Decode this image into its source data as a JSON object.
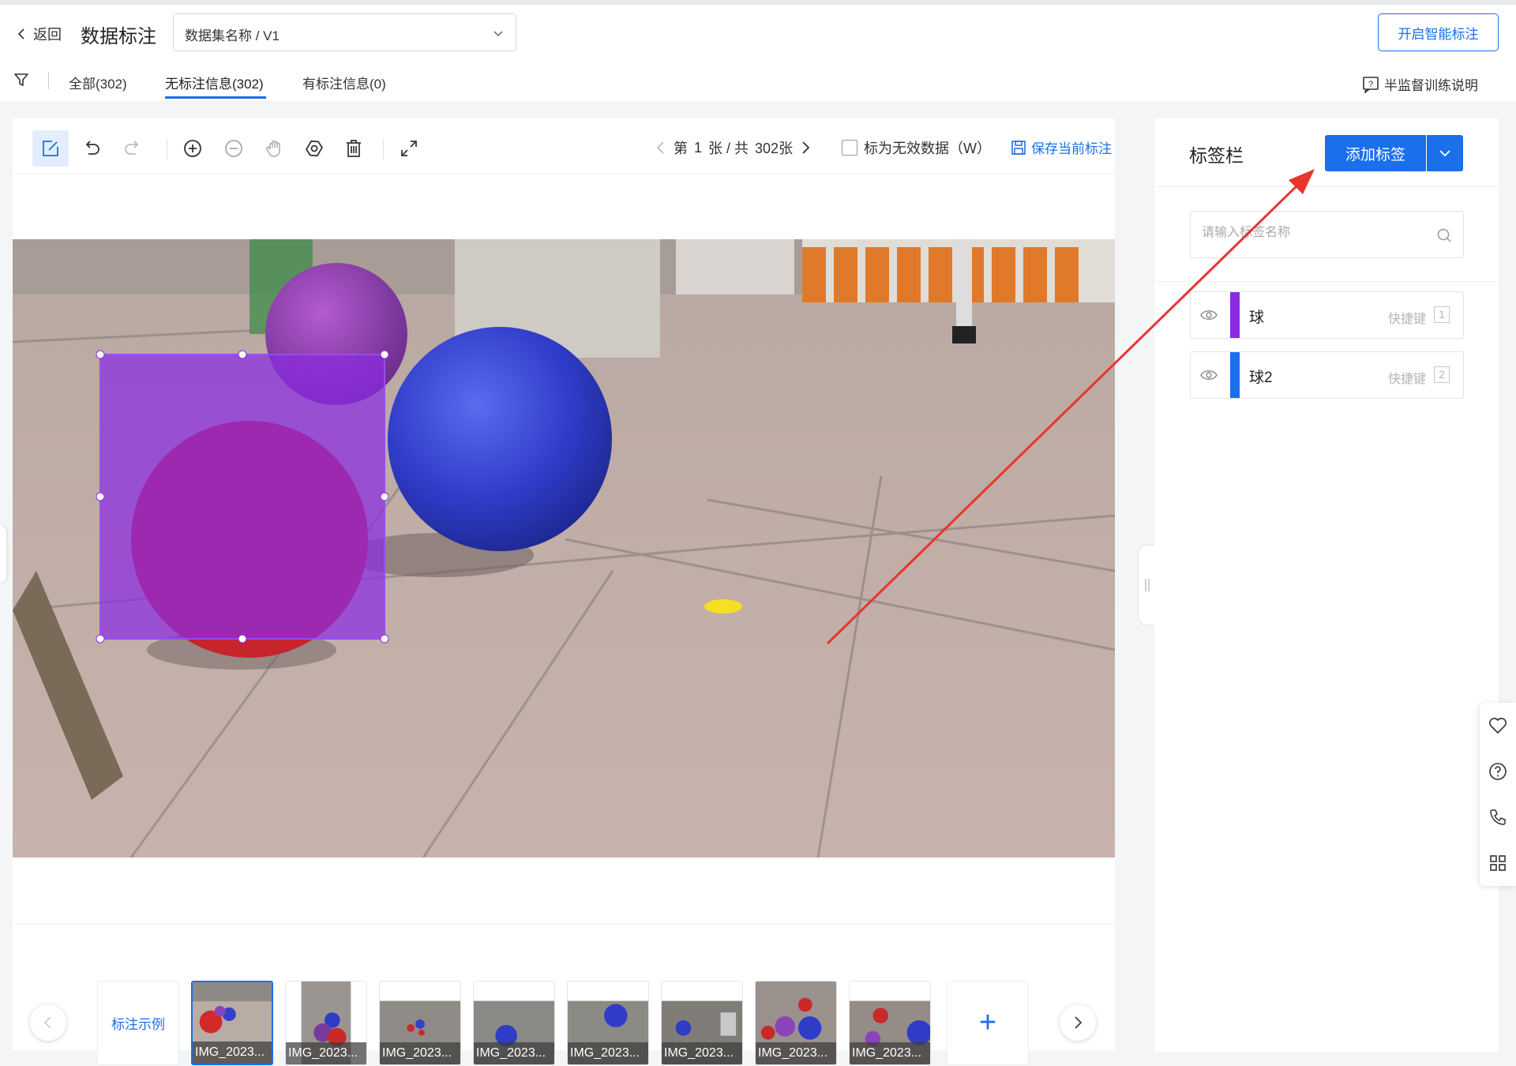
{
  "header": {
    "back_label": "返回",
    "title": "数据标注",
    "dataset_select": "数据集名称 / V1",
    "smart_label_button": "开启智能标注",
    "tabs": [
      {
        "label": "全部(302)"
      },
      {
        "label": "无标注信息(302)",
        "active": true
      },
      {
        "label": "有标注信息(0)"
      }
    ],
    "help_label": "半监督训练说明"
  },
  "toolbar": {
    "tools": [
      "edit-icon",
      "undo-icon",
      "redo-icon",
      "zoom-in-icon",
      "zoom-out-icon",
      "hand-icon",
      "eye-icon",
      "delete-icon",
      "fullscreen-icon"
    ],
    "pager": {
      "prefix": "第",
      "current": "1",
      "mid": "张 / 共",
      "total": "302张"
    },
    "invalid_label": "标为无效数据（W）",
    "save_label": "保存当前标注"
  },
  "annotation": {
    "label": "球",
    "color": "#8a2be2"
  },
  "thumbnails": {
    "example_label": "标注示例",
    "items": [
      {
        "caption": "IMG_2023...",
        "selected": true
      },
      {
        "caption": "IMG_2023..."
      },
      {
        "caption": "IMG_2023..."
      },
      {
        "caption": "IMG_2023..."
      },
      {
        "caption": "IMG_2023..."
      },
      {
        "caption": "IMG_2023..."
      },
      {
        "caption": "IMG_2023..."
      },
      {
        "caption": "IMG_2023..."
      }
    ],
    "add_label": "+"
  },
  "sidebar": {
    "title": "标签栏",
    "add_button": "添加标签",
    "search_placeholder": "请输入标签名称",
    "labels": [
      {
        "name": "球",
        "shortcut_label": "快捷键",
        "key": "1",
        "color": "#8a2be2"
      },
      {
        "name": "球2",
        "shortcut_label": "快捷键",
        "key": "2",
        "color": "#1a6fea"
      }
    ]
  },
  "floating_tools": [
    "heart-icon",
    "help-circle-icon",
    "phone-icon",
    "grid-icon"
  ],
  "colors": {
    "accent": "#1a6fea",
    "annotation_arrow": "#e8352e"
  }
}
